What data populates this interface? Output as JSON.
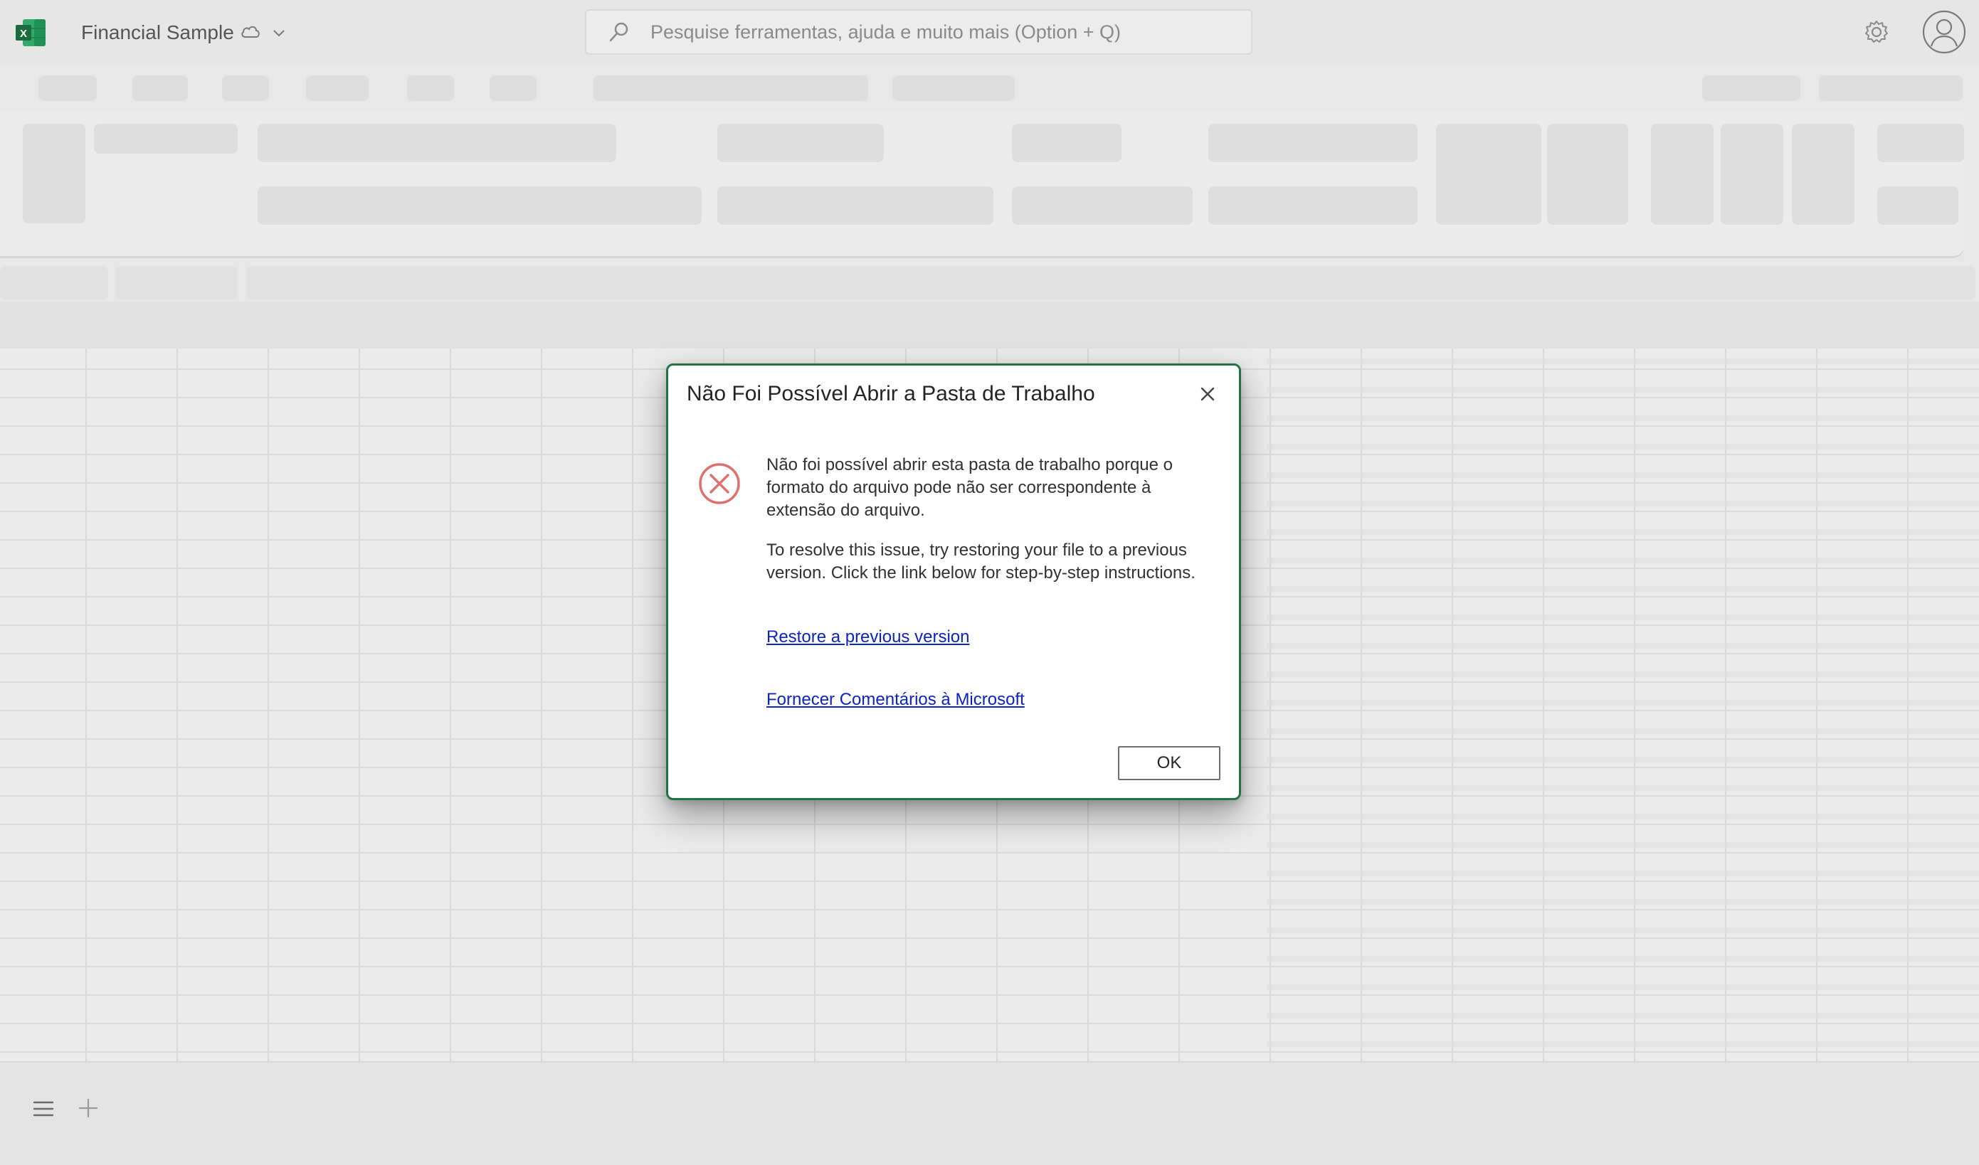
{
  "titlebar": {
    "app_icon": "excel-logo-icon",
    "document_title": "Financial Sample",
    "cloud_icon": "cloud-icon",
    "dropdown_icon": "chevron-down-icon",
    "search_placeholder": "Pesquise ferramentas, ajuda e muito mais (Option + Q)",
    "settings_icon": "gear-icon",
    "account_icon": "avatar-icon"
  },
  "bottombar": {
    "sheets_menu_icon": "hamburger-icon",
    "add_sheet_icon": "plus-icon"
  },
  "dialog": {
    "title": "Não Foi Possível Abrir a Pasta de Trabalho",
    "close_icon": "close-icon",
    "status_icon": "error-icon",
    "message_line1": "Não foi possível abrir esta pasta de trabalho porque o formato do arquivo pode não ser correspondente à extensão do arquivo.",
    "message_line2": "To resolve this issue, try restoring your file to a previous version. Click the link below for step-by-step instructions.",
    "restore_link": "Restore a previous version",
    "feedback_link": "Fornecer Comentários à Microsoft",
    "ok_label": "OK"
  },
  "colors": {
    "excel_green": "#217346",
    "link_blue": "#0b24c4",
    "error_red": "#e07070",
    "backdrop": "#e8e8e8"
  }
}
